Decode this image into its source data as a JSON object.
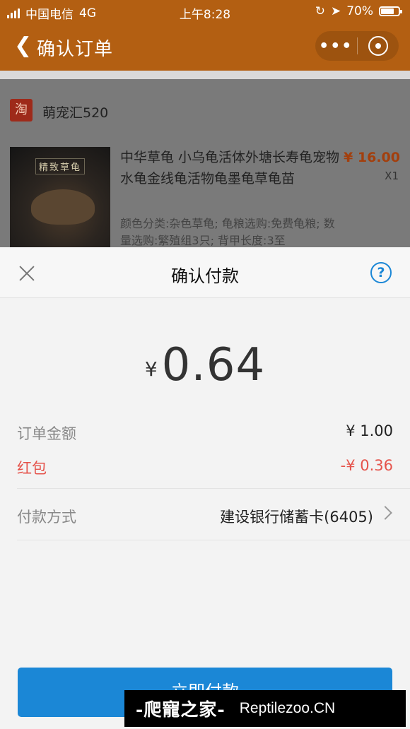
{
  "status_bar": {
    "carrier": "中国电信",
    "network": "4G",
    "time": "上午8:28",
    "battery": "70%",
    "battery_level": 0.7
  },
  "nav": {
    "back_icon": "chevron-left-icon",
    "title": "确认订单",
    "more": "•••",
    "close_icon": "target-icon"
  },
  "shop": {
    "logo": "淘",
    "name": "萌宠汇520"
  },
  "item": {
    "image_badge": "精致草龟",
    "title": "中华草龟 小乌龟活体外塘长寿龟宠物水龟金线龟活物龟墨龟草龟苗",
    "spec": "颜色分类:杂色草龟; 龟粮选购:免费龟粮; 数量选购:繁殖组3只; 背甲长度:3至",
    "price_currency": "¥",
    "price": "16.00",
    "qty": "X1"
  },
  "sheet": {
    "title": "确认付款",
    "help": "?",
    "currency": "¥",
    "amount": "0.64",
    "rows": {
      "order_label": "订单金额",
      "order_value": "¥ 1.00",
      "redpacket_label": "红包",
      "redpacket_value": "-¥ 0.36",
      "method_label": "付款方式",
      "method_value": "建设银行储蓄卡(6405)"
    },
    "pay_button": "立即付款"
  },
  "watermark": {
    "cn": "-爬寵之家-",
    "en": "Reptilezoo.CN"
  },
  "colors": {
    "nav_bg": "#b35f12",
    "accent_blue": "#1b87d6",
    "red": "#e5534b",
    "price": "#a33f0d"
  }
}
